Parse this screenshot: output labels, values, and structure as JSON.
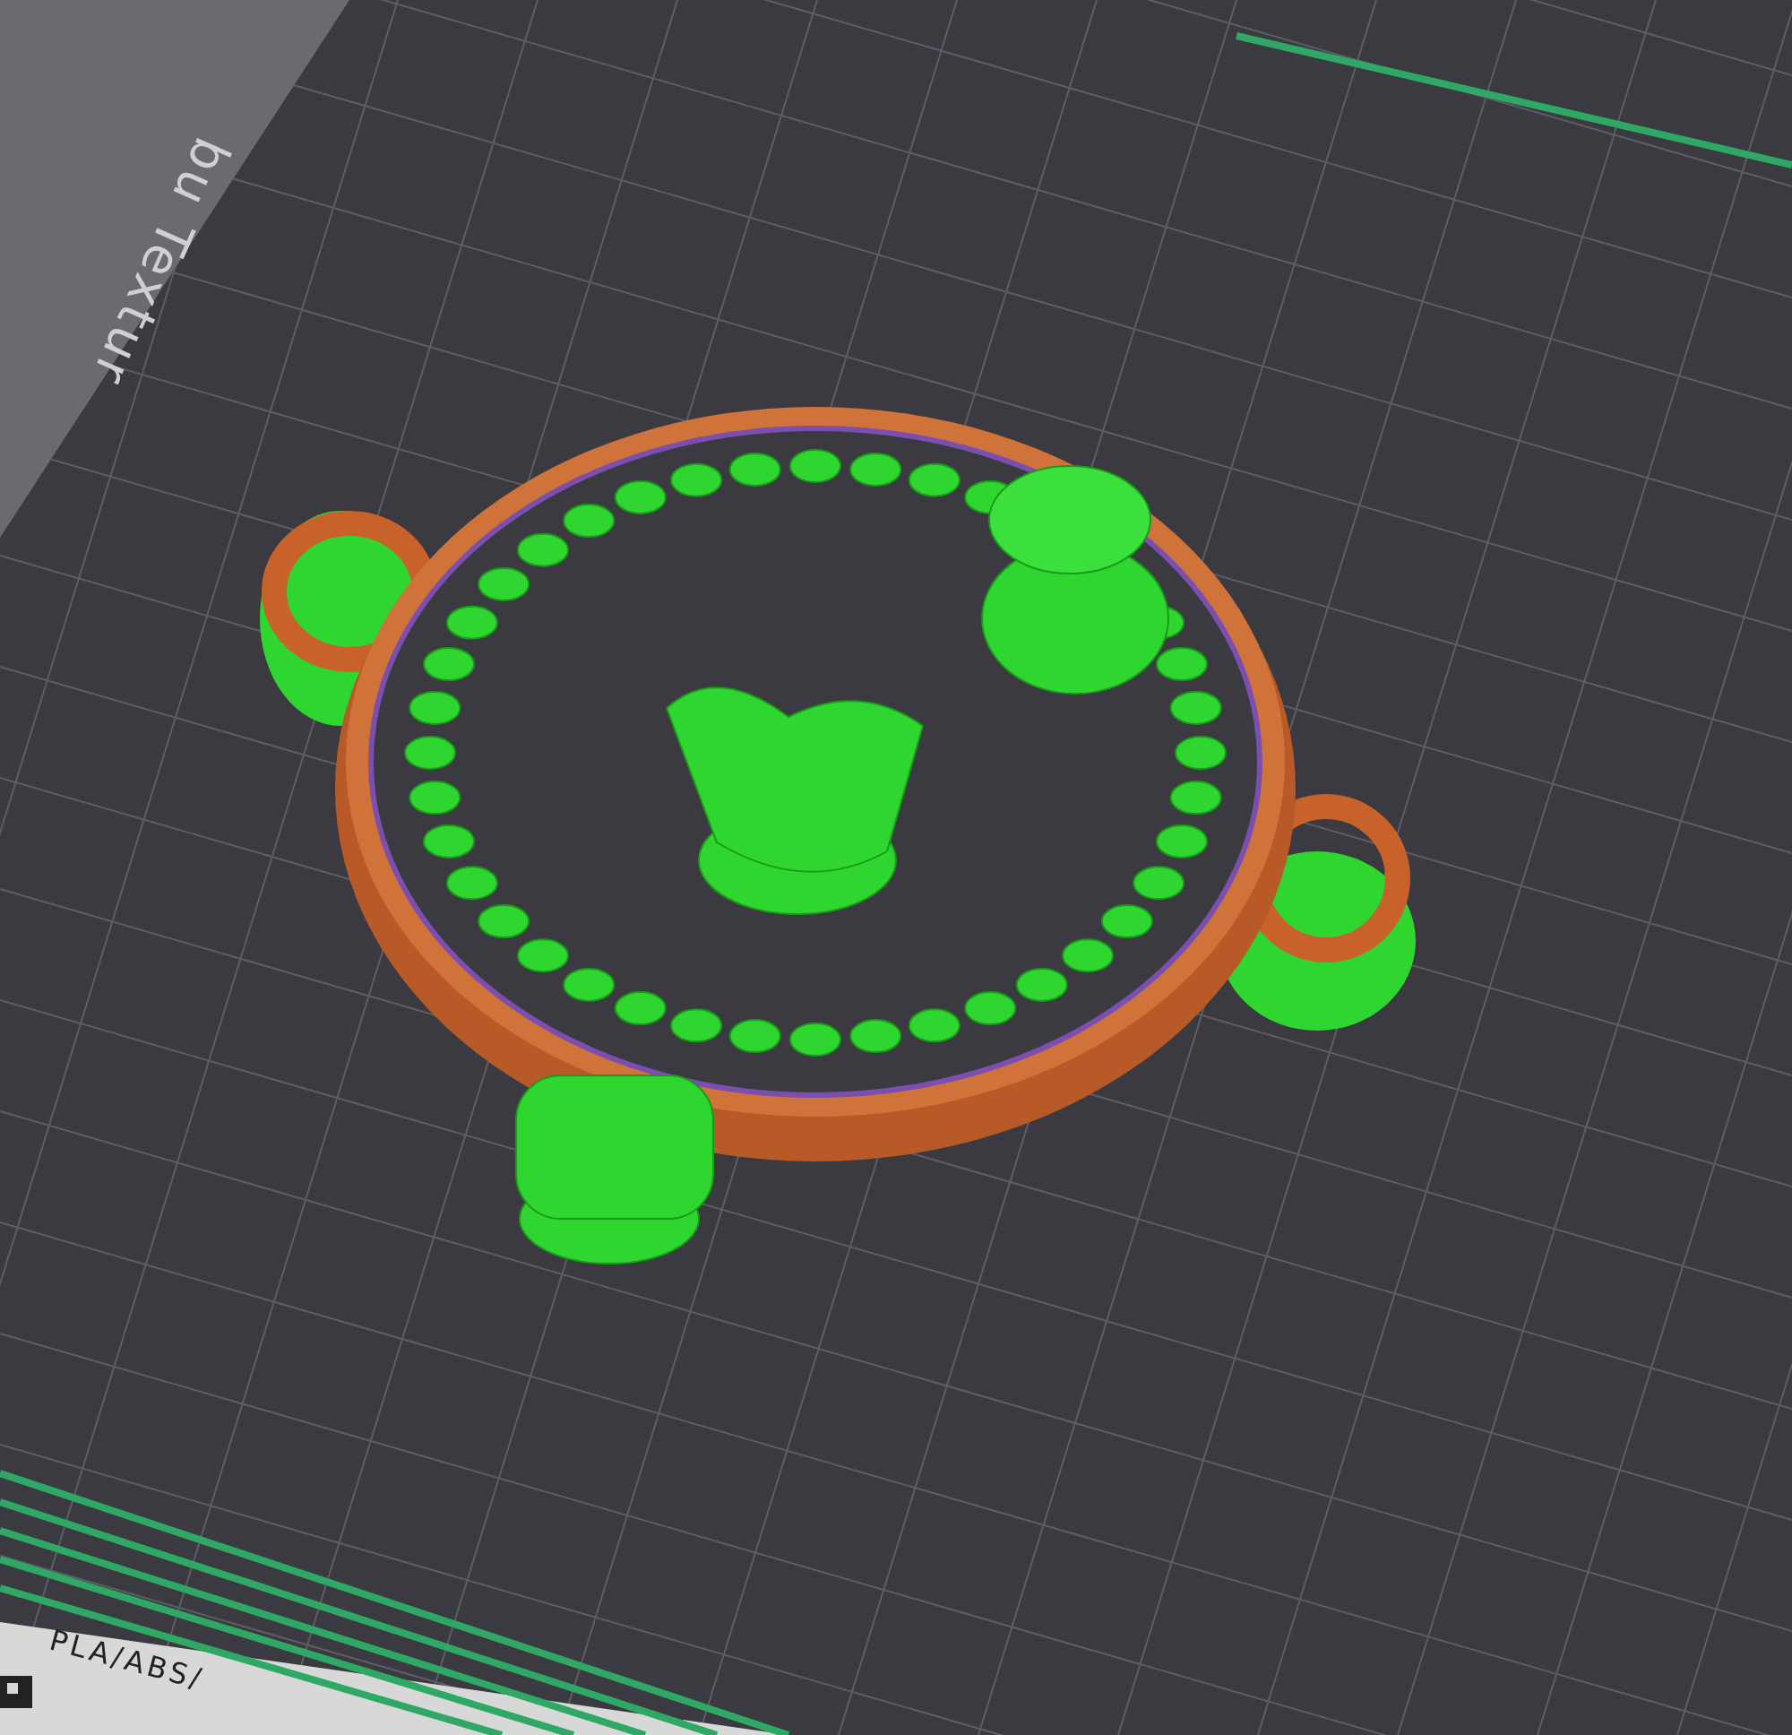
{
  "viewport": {
    "plate_label": "bu Textur",
    "plate_material_label": "PLA/ABS/"
  }
}
